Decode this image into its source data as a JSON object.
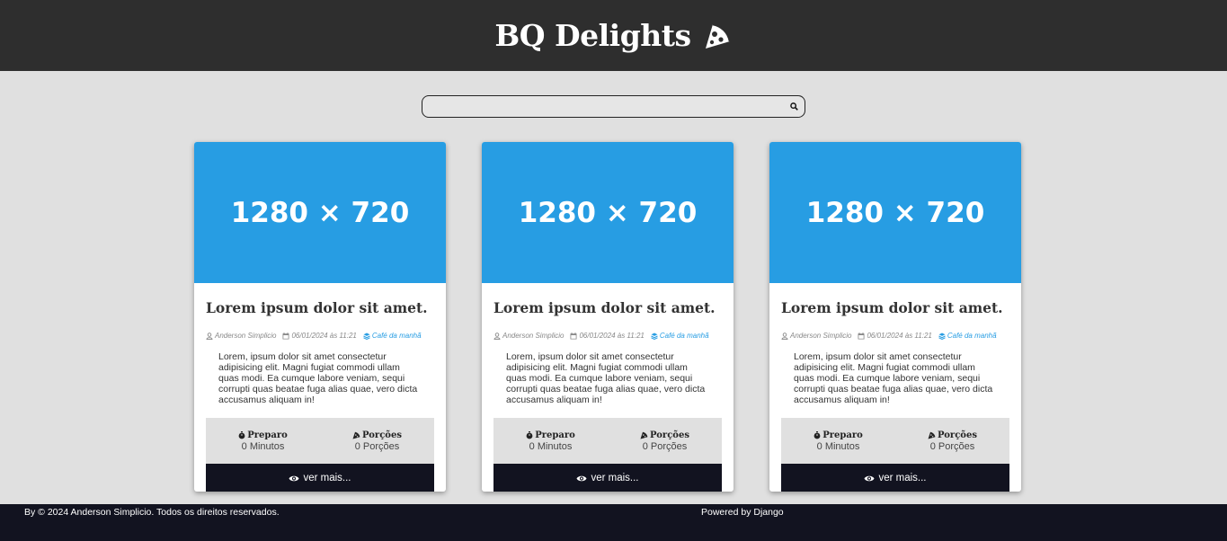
{
  "header": {
    "brand": "BQ Delights",
    "brand_icon": "pizza-slice-icon"
  },
  "search": {
    "value": "",
    "placeholder": "",
    "icon": "search-icon"
  },
  "cards": [
    {
      "image_text": "1280 × 720",
      "title": "Lorem ipsum dolor sit amet.",
      "author": "Anderson Simplicio",
      "date": "06/01/2024 às 11:21",
      "category": "Café da manhã",
      "description": "Lorem, ipsum dolor sit amet consectetur adipisicing elit. Magni fugiat commodi ullam quas modi. Ea cumque labore veniam, sequi corrupti quas beatae fuga alias quae, vero dicta accusamus aliquam in!",
      "prep_label": "Preparo",
      "prep_value": "0 Minutos",
      "servings_label": "Porções",
      "servings_value": "0 Porções",
      "more_label": "ver mais..."
    },
    {
      "image_text": "1280 × 720",
      "title": "Lorem ipsum dolor sit amet.",
      "author": "Anderson Simplicio",
      "date": "06/01/2024 às 11:21",
      "category": "Café da manhã",
      "description": "Lorem, ipsum dolor sit amet consectetur adipisicing elit. Magni fugiat commodi ullam quas modi. Ea cumque labore veniam, sequi corrupti quas beatae fuga alias quae, vero dicta accusamus aliquam in!",
      "prep_label": "Preparo",
      "prep_value": "0 Minutos",
      "servings_label": "Porções",
      "servings_value": "0 Porções",
      "more_label": "ver mais..."
    },
    {
      "image_text": "1280 × 720",
      "title": "Lorem ipsum dolor sit amet.",
      "author": "Anderson Simplicio",
      "date": "06/01/2024 às 11:21",
      "category": "Café da manhã",
      "description": "Lorem, ipsum dolor sit amet consectetur adipisicing elit. Magni fugiat commodi ullam quas modi. Ea cumque labore veniam, sequi corrupti quas beatae fuga alias quae, vero dicta accusamus aliquam in!",
      "prep_label": "Preparo",
      "prep_value": "0 Minutos",
      "servings_label": "Porções",
      "servings_value": "0 Porções",
      "more_label": "ver mais..."
    }
  ],
  "footer": {
    "copyright": "By © 2024 Anderson Simplicio. Todos os direitos reservados.",
    "powered": "Powered by Django"
  },
  "colors": {
    "header_bg": "#2e2e2e",
    "image_bg": "#279de3",
    "accent": "#279de3",
    "button_bg": "#121320",
    "footer_bg": "#121320",
    "page_bg": "#e0e0e0"
  }
}
